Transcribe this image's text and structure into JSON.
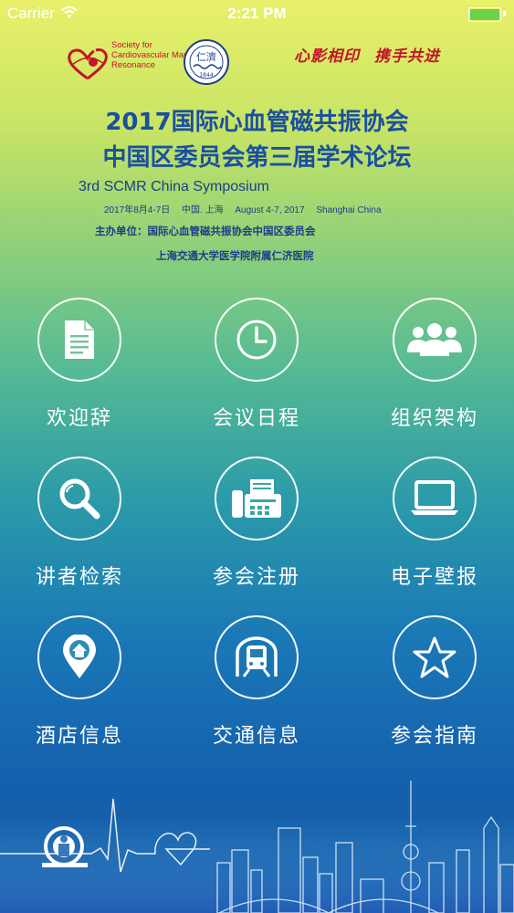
{
  "status_bar": {
    "carrier": "Carrier",
    "time": "2:21 PM"
  },
  "header": {
    "scmr_text": "Society for Cardiovascular Magnetic Resonance",
    "renji_logo_text": "仁濟",
    "renji_year": "1844",
    "slogan_1": "心影相印",
    "slogan_2": "携手共进",
    "title_line1": "2017国际心血管磁共振协会",
    "title_line2": "中国区委员会第三届学术论坛",
    "subtitle_en": "3rd SCMR China Symposium",
    "date_cn": "2017年8月4-7日",
    "place_cn": "中国. 上海",
    "date_en": "August 4-7, 2017",
    "place_en": "Shanghai  China",
    "host_line1": "主办单位：国际心血管磁共振协会中国区委员会",
    "host_line2": "上海交通大学医学院附属仁济医院"
  },
  "menu": [
    {
      "label": "欢迎辞",
      "icon": "document-icon"
    },
    {
      "label": "会议日程",
      "icon": "clock-icon"
    },
    {
      "label": "组织架构",
      "icon": "people-icon"
    },
    {
      "label": "讲者检索",
      "icon": "search-icon"
    },
    {
      "label": "参会注册",
      "icon": "fax-icon"
    },
    {
      "label": "电子壁报",
      "icon": "laptop-icon"
    },
    {
      "label": "酒店信息",
      "icon": "location-home-icon"
    },
    {
      "label": "交通信息",
      "icon": "metro-icon"
    },
    {
      "label": "参会指南",
      "icon": "star-icon"
    }
  ],
  "colors": {
    "title": "#1b4fa0",
    "slogan": "#c0152a",
    "accent_green": "#6bd24a"
  }
}
